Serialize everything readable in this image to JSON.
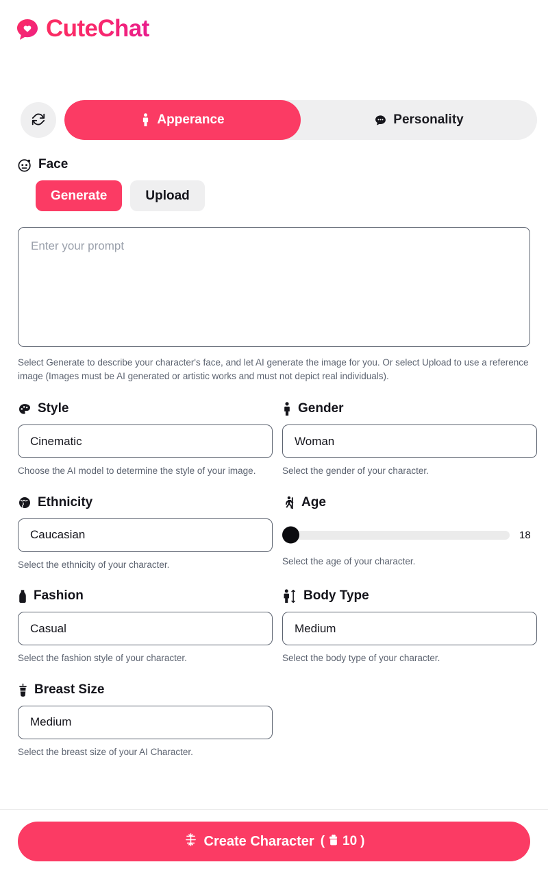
{
  "brand": {
    "name": "CuteChat",
    "accent": "#fb3b64",
    "logo_icon": "chat-bubble-heart-icon"
  },
  "toolbar": {
    "reset_icon": "refresh-icon",
    "tabs": [
      {
        "label": "Apperance",
        "icon": "person-icon",
        "active": true
      },
      {
        "label": "Personality",
        "icon": "speech-bubble-icon",
        "active": false
      }
    ]
  },
  "face": {
    "label": "Face",
    "icon": "face-icon",
    "generate_label": "Generate",
    "upload_label": "Upload",
    "active_mode": "Generate",
    "prompt_value": "",
    "prompt_placeholder": "Enter your prompt",
    "hint": "Select Generate to describe your character's face, and let AI generate the image for you. Or select Upload to use a reference image (Images must be AI generated or artistic works and must not depict real individuals)."
  },
  "fields": {
    "style": {
      "label": "Style",
      "icon": "palette-icon",
      "value": "Cinematic",
      "hint": "Choose the AI model to determine the style of your image."
    },
    "gender": {
      "label": "Gender",
      "icon": "person-icon",
      "value": "Woman",
      "hint": "Select the gender of your character."
    },
    "ethnicity": {
      "label": "Ethnicity",
      "icon": "globe-icon",
      "value": "Caucasian",
      "hint": "Select the ethnicity of your character."
    },
    "age": {
      "label": "Age",
      "icon": "walking-person-icon",
      "value": "18",
      "min": "18",
      "max": "60",
      "hint": "Select the age of your character."
    },
    "fashion": {
      "label": "Fashion",
      "icon": "dress-icon",
      "value": "Casual",
      "hint": "Select the fashion style of your character."
    },
    "body_type": {
      "label": "Body Type",
      "icon": "body-measure-icon",
      "value": "Medium",
      "hint": "Select the body type of your character."
    },
    "breast_size": {
      "label": "Breast Size",
      "icon": "breast-size-icon",
      "value": "Medium",
      "hint": "Select the breast size of your AI Character."
    }
  },
  "footer": {
    "create_label": "Create Character",
    "cost_open": "(",
    "cost_value": "10",
    "cost_close": ")",
    "cost_icon": "token-gift-icon",
    "magic_icon": "sparkle-icon"
  }
}
